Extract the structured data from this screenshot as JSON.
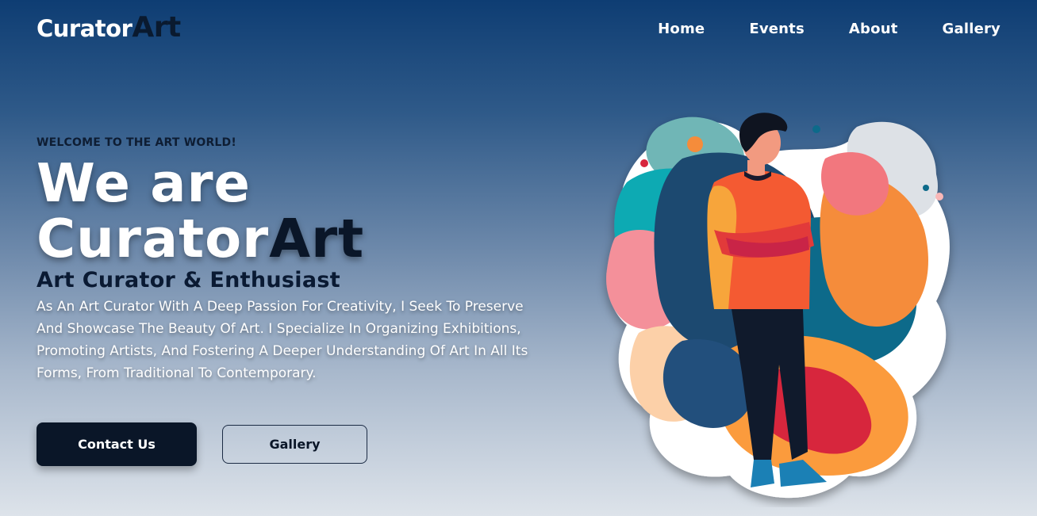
{
  "brand": {
    "part1": "Curator",
    "part2": "Art"
  },
  "nav": {
    "items": [
      {
        "label": "Home"
      },
      {
        "label": "Events"
      },
      {
        "label": "About"
      },
      {
        "label": "Gallery"
      }
    ]
  },
  "hero": {
    "eyebrow": "WELCOME TO THE ART WORLD!",
    "headline_line1": "We are",
    "headline_line2_part1": "Curator",
    "headline_line2_part2": "Art",
    "subtitle": "Art Curator & Enthusiast",
    "description": "As An Art Curator With A Deep Passion For Creativity, I Seek To Preserve And Showcase The Beauty Of Art. I Specialize In Organizing Exhibitions, Promoting Artists, And Fostering A Deeper Understanding Of Art In All Its Forms, From Traditional To Contemporary.",
    "primary_button": "Contact Us",
    "secondary_button": "Gallery"
  },
  "colors": {
    "accent_dark": "#0a1628",
    "gradient_top": "#0e3d73",
    "gradient_bottom": "#dde3ea"
  },
  "illustration": {
    "icon": "man-with-colorful-abstract-shapes-illustration"
  }
}
